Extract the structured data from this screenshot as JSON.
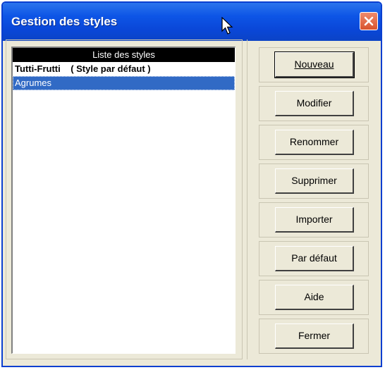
{
  "window": {
    "title": "Gestion des styles"
  },
  "style_list": {
    "header": "Liste des styles",
    "items": [
      {
        "name": "Tutti-Frutti",
        "note": "( Style par défaut )",
        "is_default": true,
        "selected": false
      },
      {
        "name": "Agrumes",
        "note": "",
        "is_default": false,
        "selected": true
      }
    ]
  },
  "buttons": {
    "new": "Nouveau",
    "modify": "Modifier",
    "rename": "Renommer",
    "delete": "Supprimer",
    "import": "Importer",
    "set_default": "Par défaut",
    "help": "Aide",
    "close": "Fermer"
  },
  "icons": {
    "close": "close-icon",
    "cursor": "mouse-pointer-icon"
  },
  "colors": {
    "titlebar": "#0a47d8",
    "selection": "#316ac5",
    "dialog": "#ece9d8",
    "close_button": "#e0603c"
  }
}
